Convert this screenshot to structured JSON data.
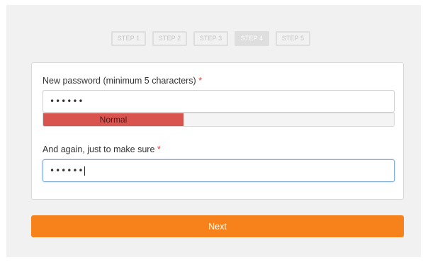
{
  "steps": [
    {
      "label": "STEP 1",
      "active": false
    },
    {
      "label": "STEP 2",
      "active": false
    },
    {
      "label": "STEP 3",
      "active": false
    },
    {
      "label": "STEP 4",
      "active": true
    },
    {
      "label": "STEP 5",
      "active": false
    }
  ],
  "form": {
    "password_label": "New password (minimum 5 characters)",
    "password_value": "••••••",
    "strength_label": "Normal",
    "strength_level": 0.4,
    "strength_color": "#d9534f",
    "confirm_label": "And again, just to make sure",
    "confirm_value": "••••••",
    "required_marker": "*"
  },
  "actions": {
    "next_label": "Next"
  },
  "colors": {
    "accent": "#f7821b",
    "required": "#e53935",
    "focus_border": "#7fa9d6"
  }
}
